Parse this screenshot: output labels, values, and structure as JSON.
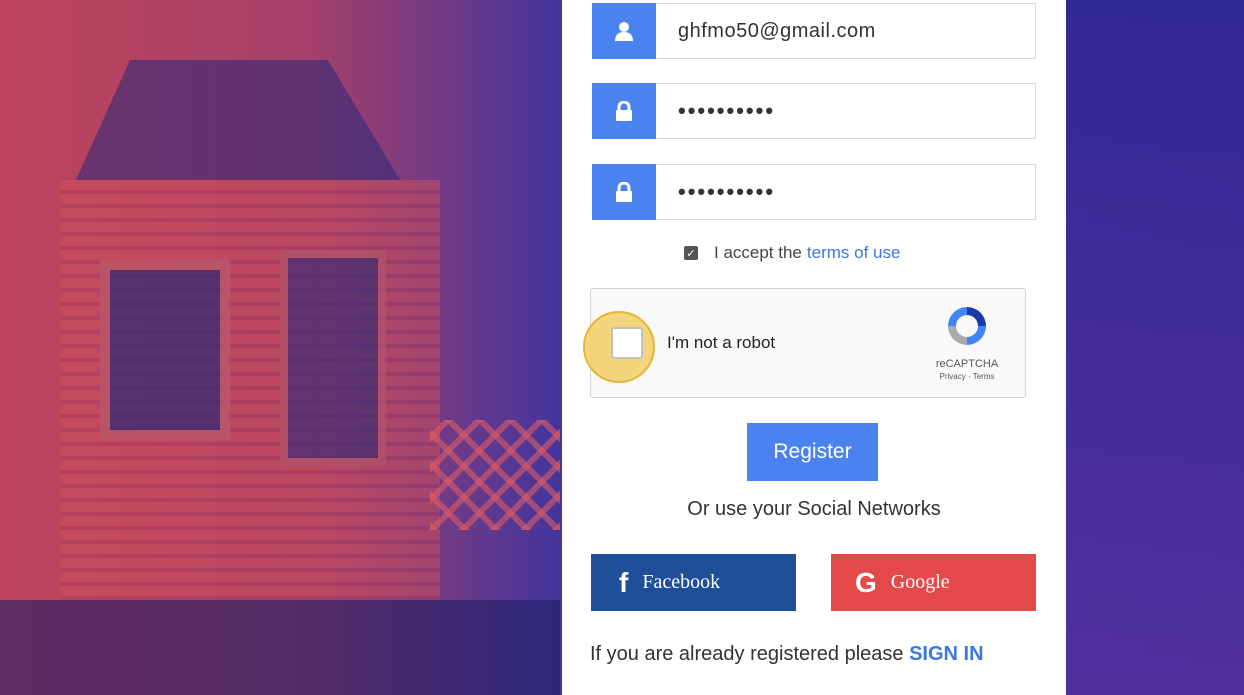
{
  "form": {
    "email_value": "ghfmo50@gmail.com",
    "password_value": "••••••••••",
    "confirm_password_value": "••••••••••"
  },
  "terms": {
    "prefix": "I accept the",
    "link": "terms of use"
  },
  "recaptcha": {
    "label": "I'm not a robot",
    "brand": "reCAPTCHA",
    "links": "Privacy · Terms"
  },
  "register_label": "Register",
  "social": {
    "heading": "Or use your Social Networks",
    "facebook_label": "Facebook",
    "google_label": "Google",
    "facebook_icon": "f",
    "google_icon": "G"
  },
  "signin": {
    "prefix": "If you are already registered please",
    "link": "SIGN IN"
  },
  "colors": {
    "accent": "#4a83f0",
    "facebook": "#1f4f98",
    "google": "#e44a4a",
    "link": "#3a78e0"
  }
}
